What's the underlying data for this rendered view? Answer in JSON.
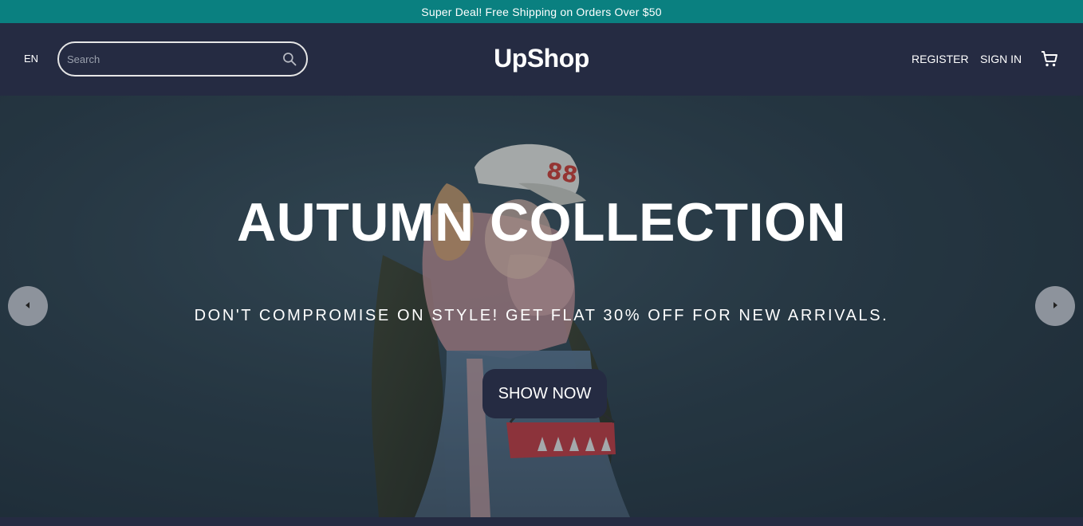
{
  "announcement": {
    "text": "Super Deal! Free Shipping on Orders Over $50",
    "background": "#0a8080"
  },
  "header": {
    "language": "EN",
    "search": {
      "placeholder": "Search",
      "value": "",
      "icon": "search-icon"
    },
    "logo": "UpShop",
    "nav": {
      "register": "REGISTER",
      "sign_in": "SIGN IN",
      "cart_icon": "cart-icon"
    },
    "background": "#252b42"
  },
  "hero": {
    "title": "AUTUMN COLLECTION",
    "subtitle": "DON'T COMPROMISE ON STYLE! GET FLAT 30% OFF FOR NEW ARRIVALS.",
    "cta_label": "SHOW NOW",
    "prev_icon": "chevron-left-icon",
    "next_icon": "chevron-right-icon"
  }
}
